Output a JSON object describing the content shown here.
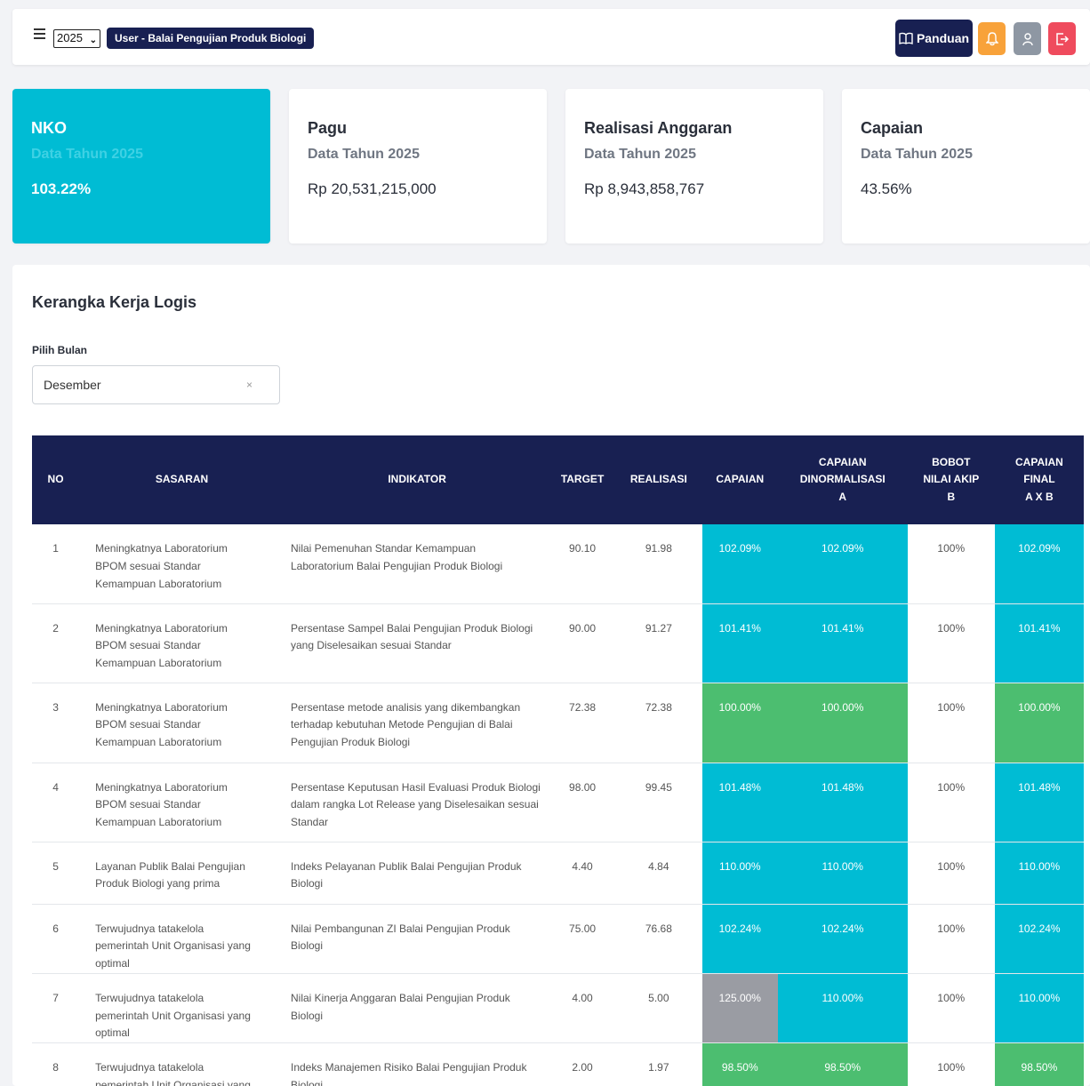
{
  "topbar": {
    "year": "2025",
    "user_label": "User - Balai Pengujian Produk Biologi",
    "panduan_label": "Panduan"
  },
  "cards": [
    {
      "title": "NKO",
      "subtitle": "Data Tahun 2025",
      "value": "103.22%"
    },
    {
      "title": "Pagu",
      "subtitle": "Data Tahun 2025",
      "value": "Rp 20,531,215,000"
    },
    {
      "title": "Realisasi Anggaran",
      "subtitle": "Data Tahun 2025",
      "value": "Rp 8,943,858,767"
    },
    {
      "title": "Capaian",
      "subtitle": "Data Tahun 2025",
      "value": "43.56%"
    }
  ],
  "section": {
    "title": "Kerangka Kerja Logis",
    "month_label": "Pilih Bulan",
    "month_value": "Desember",
    "clear_symbol": "×"
  },
  "table": {
    "headers": {
      "no": "NO",
      "sasaran": "SASARAN",
      "indikator": "INDIKATOR",
      "target": "TARGET",
      "realisasi": "REALISASI",
      "capaian": "CAPAIAN",
      "norm_1": "CAPAIAN",
      "norm_2": "DINORMALISASI",
      "norm_3": "A",
      "bobot_1": "BOBOT",
      "bobot_2": "NILAI AKIP",
      "bobot_3": "B",
      "final_1": "CAPAIAN",
      "final_2": "FINAL",
      "final_3": "A X B"
    },
    "rows": [
      {
        "no": "1",
        "sasaran": "Meningkatnya Laboratorium BPOM sesuai Standar Kemampuan Laboratorium",
        "indikator": "Nilai Pemenuhan Standar Kemampuan Laboratorium Balai Pengujian Produk Biologi",
        "target": "90.10",
        "realisasi": "91.98",
        "capaian": "102.09%",
        "normal": "102.09%",
        "bobot": "100%",
        "final": "102.09%",
        "color_capaian": "#00bcd4",
        "color_normal": "#00bcd4",
        "color_final": "#00bcd4"
      },
      {
        "no": "2",
        "sasaran": "Meningkatnya Laboratorium BPOM sesuai Standar Kemampuan Laboratorium",
        "indikator": "Persentase Sampel Balai Pengujian Produk Biologi yang Diselesaikan sesuai Standar",
        "target": "90.00",
        "realisasi": "91.27",
        "capaian": "101.41%",
        "normal": "101.41%",
        "bobot": "100%",
        "final": "101.41%",
        "color_capaian": "#00bcd4",
        "color_normal": "#00bcd4",
        "color_final": "#00bcd4"
      },
      {
        "no": "3",
        "sasaran": "Meningkatnya Laboratorium BPOM sesuai Standar Kemampuan Laboratorium",
        "indikator": "Persentase metode analisis yang dikembangkan terhadap kebutuhan Metode Pengujian di Balai Pengujian Produk Biologi",
        "target": "72.38",
        "realisasi": "72.38",
        "capaian": "100.00%",
        "normal": "100.00%",
        "bobot": "100%",
        "final": "100.00%",
        "color_capaian": "#4cbe70",
        "color_normal": "#4cbe70",
        "color_final": "#4cbe70"
      },
      {
        "no": "4",
        "sasaran": "Meningkatnya Laboratorium BPOM sesuai Standar Kemampuan Laboratorium",
        "indikator": "Persentase Keputusan Hasil Evaluasi Produk Biologi dalam rangka Lot Release yang Diselesaikan sesuai Standar",
        "target": "98.00",
        "realisasi": "99.45",
        "capaian": "101.48%",
        "normal": "101.48%",
        "bobot": "100%",
        "final": "101.48%",
        "color_capaian": "#00bcd4",
        "color_normal": "#00bcd4",
        "color_final": "#00bcd4"
      },
      {
        "no": "5",
        "sasaran": "Layanan Publik Balai Pengujian Produk Biologi yang prima",
        "indikator": "Indeks Pelayanan Publik Balai Pengujian Produk Biologi",
        "target": "4.40",
        "realisasi": "4.84",
        "capaian": "110.00%",
        "normal": "110.00%",
        "bobot": "100%",
        "final": "110.00%",
        "color_capaian": "#00bcd4",
        "color_normal": "#00bcd4",
        "color_final": "#00bcd4"
      },
      {
        "no": "6",
        "sasaran": "Terwujudnya tatakelola pemerintah Unit Organisasi yang optimal",
        "indikator": "Nilai Pembangunan ZI Balai Pengujian Produk Biologi",
        "target": "75.00",
        "realisasi": "76.68",
        "capaian": "102.24%",
        "normal": "102.24%",
        "bobot": "100%",
        "final": "102.24%",
        "color_capaian": "#00bcd4",
        "color_normal": "#00bcd4",
        "color_final": "#00bcd4"
      },
      {
        "no": "7",
        "sasaran": "Terwujudnya tatakelola pemerintah Unit Organisasi yang optimal",
        "indikator": "Nilai Kinerja Anggaran Balai Pengujian Produk Biologi",
        "target": "4.00",
        "realisasi": "5.00",
        "capaian": "125.00%",
        "normal": "110.00%",
        "bobot": "100%",
        "final": "110.00%",
        "color_capaian": "#9a9ca3",
        "color_normal": "#00bcd4",
        "color_final": "#00bcd4"
      },
      {
        "no": "8",
        "sasaran": "Terwujudnya tatakelola pemerintah Unit Organisasi yang optimal",
        "indikator": "Indeks Manajemen Risiko Balai Pengujian Produk Biologi",
        "target": "2.00",
        "realisasi": "1.97",
        "capaian": "98.50%",
        "normal": "98.50%",
        "bobot": "100%",
        "final": "98.50%",
        "color_capaian": "#4cbe70",
        "color_normal": "#4cbe70",
        "color_final": "#4cbe70"
      }
    ]
  }
}
